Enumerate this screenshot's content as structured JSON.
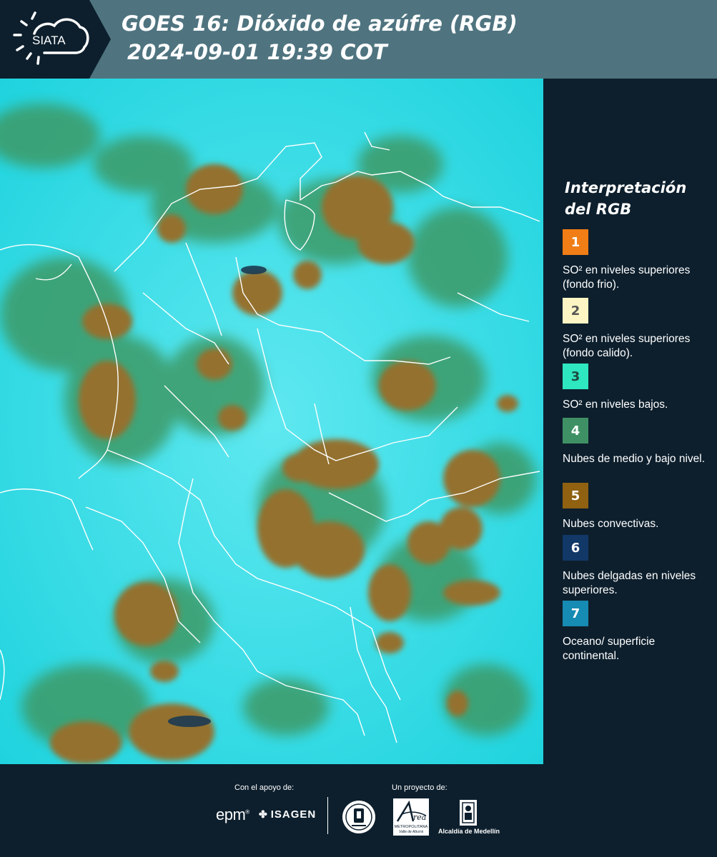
{
  "header": {
    "logo_text": "SIATA",
    "title_line1": "GOES 16: Dióxido de azúfre (RGB)",
    "title_line2": " 2024-09-01 19:39 COT"
  },
  "map": {
    "icons": [
      "sun-cloud-logo-icon"
    ],
    "colors": {
      "background_cyan": "#2ad9e3",
      "low_cloud_green": "#3b9564",
      "convective_brown": "#95702f",
      "borders": "#ffffff"
    }
  },
  "legend": {
    "title": "Interpretación del RGB",
    "items": [
      {
        "number": "1",
        "color": "#f07d16",
        "number_color": "#ffffff",
        "text": "SO² en niveles superiores (fondo frio)."
      },
      {
        "number": "2",
        "color": "#fdf5c4",
        "number_color": "#555555",
        "text": "SO² en niveles superiores (fondo calido)."
      },
      {
        "number": "3",
        "color": "#2ee6c0",
        "number_color": "#1d4a3d",
        "text": "SO² en niveles bajos."
      },
      {
        "number": "4",
        "color": "#3f9165",
        "number_color": "#ffffff",
        "text": "Nubes de medio y bajo nivel."
      },
      {
        "number": "5",
        "color": "#8f6111",
        "number_color": "#ffffff",
        "text": "Nubes convectivas."
      },
      {
        "number": "6",
        "color": "#123868",
        "number_color": "#ffffff",
        "text": "Nubes delgadas en niveles superiores."
      },
      {
        "number": "7",
        "color": "#168bb3",
        "number_color": "#ffffff",
        "text": "Oceano/ superficie continental."
      }
    ]
  },
  "footer": {
    "support_label": "Con el apoyo de:",
    "project_label": "Un proyecto de:",
    "epm_text": "epm",
    "isagen_text": "ISAGEN",
    "area_text_1": "METROPOLITANA",
    "area_text_2": "Valle de Aburrá",
    "alcaldia_text": "Alcaldía de Medellín"
  }
}
